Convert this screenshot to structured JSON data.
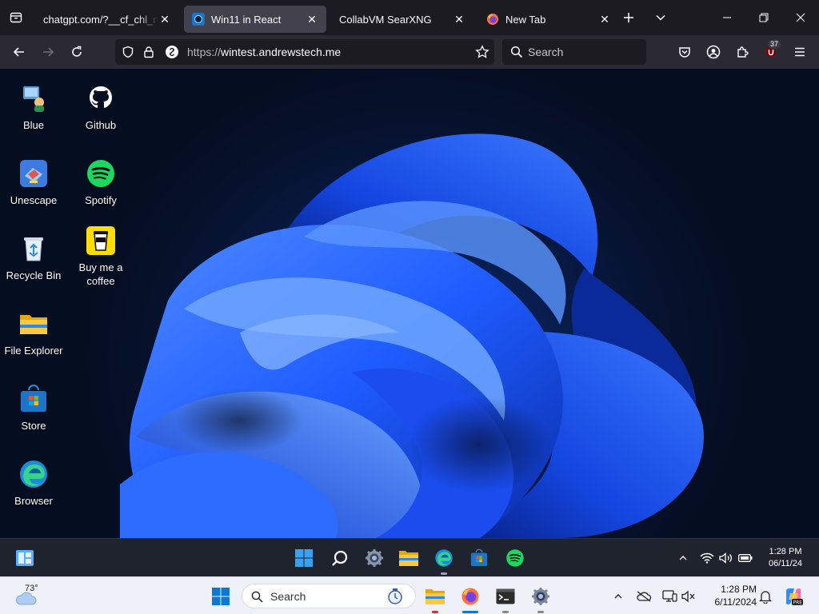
{
  "browser": {
    "tabs": [
      {
        "title": "chatgpt.com/?__cf_chl_rt_tk=",
        "active": false
      },
      {
        "title": "Win11 in React",
        "active": true
      },
      {
        "title": "CollabVM SearXNG",
        "active": false
      },
      {
        "title": "New Tab",
        "active": false
      }
    ],
    "url_prefix": "https://",
    "url_host": "wintest.andrewstech.me",
    "search_placeholder": "Search",
    "extension_badge": "37"
  },
  "desktop": {
    "icons": [
      {
        "label": "Blue",
        "icon": "blue-app-icon"
      },
      {
        "label": "Github",
        "icon": "github-icon"
      },
      {
        "label": "Unescape",
        "icon": "unescape-icon"
      },
      {
        "label": "Spotify",
        "icon": "spotify-icon"
      },
      {
        "label": "Recycle Bin",
        "icon": "recycle-bin-icon"
      },
      {
        "label": "Buy me a coffee",
        "icon": "coffee-icon"
      },
      {
        "label": "File Explorer",
        "icon": "folder-icon"
      },
      {
        "label": "Store",
        "icon": "store-icon"
      },
      {
        "label": "Browser",
        "icon": "edge-icon"
      }
    ]
  },
  "win11_taskbar": {
    "apps": [
      "widgets",
      "start",
      "search",
      "settings",
      "file-explorer",
      "edge",
      "store",
      "spotify"
    ],
    "time": "1:28 PM",
    "date": "06/11/24"
  },
  "host_taskbar": {
    "weather_temp": "73°",
    "search_placeholder": "Search",
    "time": "1:28 PM",
    "date": "6/11/2024"
  },
  "colors": {
    "firefox_dark": "#1c1b22",
    "firefox_toolbar": "#2b2a33",
    "bloom_blue": "#1f5cff",
    "spotify_green": "#1ed760",
    "host_taskbar": "#eef1f7"
  }
}
